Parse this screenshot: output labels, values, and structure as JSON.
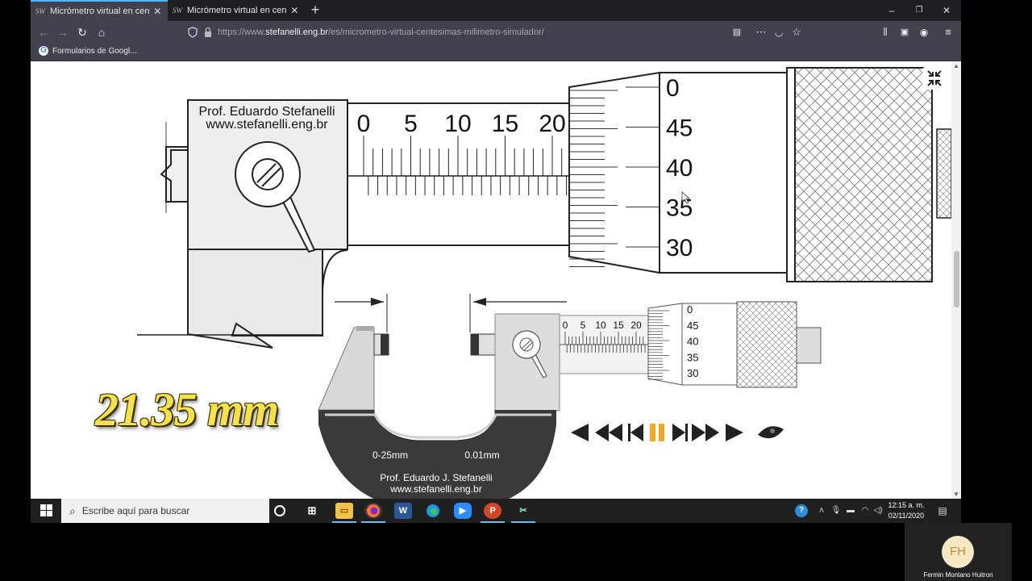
{
  "browser": {
    "tabs": [
      {
        "favicon": "SW",
        "title": "Micrómetro virtual en centésim",
        "active": true
      },
      {
        "favicon": "SW",
        "title": "Micrómetro virtual en centésim",
        "active": false
      }
    ],
    "new_tab": "+",
    "window_controls": {
      "minimize": "–",
      "restore": "❐",
      "close": "✕"
    },
    "nav": {
      "back": "←",
      "forward": "→",
      "reload": "↻",
      "home": "⌂"
    },
    "url": {
      "prefix": "https://www.",
      "host": "stefanelli.eng.br",
      "path": "/es/micrometro-virtual-centesimas-milimetro-simulador/"
    },
    "bookmark": {
      "icon": "G",
      "label": "Formularios de Googl..."
    }
  },
  "simulator": {
    "readout": "21.35 mm",
    "big": {
      "credit_line1": "Prof. Eduardo Stefanelli",
      "credit_line2": "www.stefanelli.eng.br",
      "sleeve_labels": [
        "0",
        "5",
        "10",
        "15",
        "20"
      ],
      "thimble_labels": [
        "0",
        "45",
        "40",
        "35",
        "30"
      ]
    },
    "small": {
      "sleeve_labels": [
        "0",
        "5",
        "10",
        "15",
        "20"
      ],
      "thimble_labels": [
        "0",
        "45",
        "40",
        "35",
        "30"
      ],
      "range": "0-25mm",
      "resolution": "0.01mm",
      "credit_line1": "Prof. Eduardo J. Stefanelli",
      "credit_line2": "www.stefanelli.eng.br"
    },
    "controls": [
      "first",
      "rewind-fast",
      "step-back",
      "pause",
      "step-forward",
      "forward-fast",
      "last",
      "eye"
    ]
  },
  "taskbar": {
    "search_placeholder": "Escribe aquí para buscar",
    "time": "12:15 a. m.",
    "date": "02/11/2020"
  },
  "participant": {
    "initials": "FH",
    "name": "Fermin Montano Huitron"
  },
  "colors": {
    "accent": "#56b5ff",
    "readout": "#f5e14a",
    "pause": "#f5a623"
  }
}
